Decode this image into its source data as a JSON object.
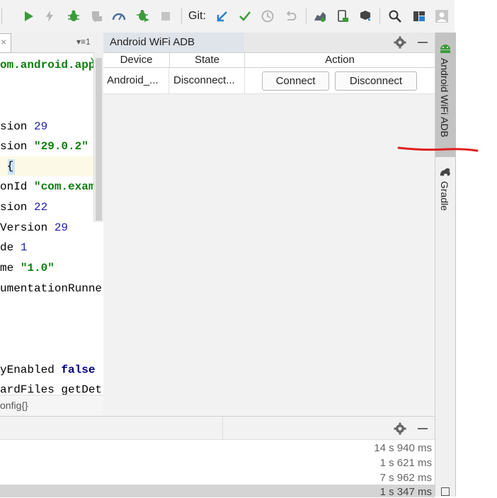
{
  "toolbar": {
    "git_label": "Git:",
    "icons": [
      "run-icon",
      "flash-icon",
      "debug-icon",
      "coverage-icon",
      "profiler-icon",
      "attach-debugger-icon",
      "stop-icon",
      "git-update-icon",
      "git-commit-icon",
      "history-icon",
      "rollback-icon",
      "avd-manager-icon",
      "device-file-icon",
      "sdk-manager-icon",
      "search-icon",
      "project-structure-icon",
      "user-icon"
    ]
  },
  "editor": {
    "tab_menu": "▾≡1",
    "lines": [
      {
        "pre": "om.android.app",
        "str": "",
        "num": "",
        "kw": "",
        "post": "",
        "marker": "Y"
      },
      {
        "pre": "sion ",
        "num": "29"
      },
      {
        "pre": "sion ",
        "str": "\"29.0.2\""
      },
      {
        "pre": " ",
        "brace": "{"
      },
      {
        "pre": "onId ",
        "str": "\"com.examp"
      },
      {
        "pre": "sion ",
        "num": "22"
      },
      {
        "pre": "Version ",
        "num": "29"
      },
      {
        "pre": "de ",
        "num": "1"
      },
      {
        "pre": "me ",
        "str": "\"1.0\""
      },
      {
        "pre": "umentationRunne"
      },
      {
        "pre": "yEnabled ",
        "kw": "false"
      },
      {
        "pre": "ardFiles getDet"
      }
    ],
    "breadcrumb": "onfig{}"
  },
  "adb_panel": {
    "title": "Android WiFi ADB",
    "columns": [
      "Device",
      "State",
      "Action"
    ],
    "rows": [
      {
        "device": "Android_...",
        "state": "Disconnect...",
        "connect": "Connect",
        "disconnect": "Disconnect"
      }
    ]
  },
  "stripe": {
    "adb_label": "Android WiFi ADB",
    "gradle_label": "Gradle"
  },
  "bottom_panel": {
    "timings": [
      "14 s 940 ms",
      "1 s 621 ms",
      "7 s 962 ms",
      "1 s 347 ms"
    ]
  },
  "colors": {
    "annotation_red": "#e02020",
    "run_green": "#3c9a3c",
    "commit_green": "#3c9a3c",
    "update_blue": "#2a7fd4"
  }
}
